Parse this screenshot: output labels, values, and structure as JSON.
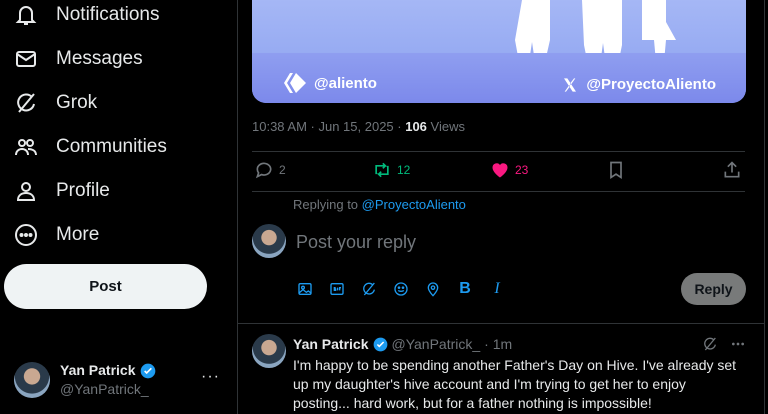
{
  "nav": {
    "items": [
      {
        "label": "Notifications",
        "icon": "bell-icon"
      },
      {
        "label": "Messages",
        "icon": "envelope-icon"
      },
      {
        "label": "Grok",
        "icon": "grok-icon"
      },
      {
        "label": "Communities",
        "icon": "people-icon"
      },
      {
        "label": "Profile",
        "icon": "person-icon"
      },
      {
        "label": "More",
        "icon": "more-circle-icon"
      }
    ],
    "post_label": "Post"
  },
  "account": {
    "name": "Yan Patrick",
    "handle": "@YanPatrick_",
    "more": "···"
  },
  "media": {
    "left_handle": "@aliento",
    "right_handle": "@ProyectoAliento"
  },
  "post_meta": {
    "time": "10:38 AM · Jun 15, 2025 · ",
    "views_count": "106",
    "views_label": " Views"
  },
  "actions": {
    "replies": "2",
    "reposts": "12",
    "likes": "23"
  },
  "reply": {
    "replying_prefix": "Replying to ",
    "replying_to": "@ProyectoAliento",
    "placeholder": "Post your reply",
    "button": "Reply"
  },
  "tweet": {
    "name": "Yan Patrick",
    "handle": "@YanPatrick_",
    "time": "· 1m",
    "text": "I'm happy to be spending another Father's Day on Hive. I've already set up my daughter's hive account and I'm trying to get her to enjoy posting... hard work, but for a father nothing is impossible!"
  },
  "colors": {
    "accent": "#1d9bf0",
    "like": "#f91880",
    "repost": "#00ba7c",
    "media_bg": "#9aaaf3"
  }
}
